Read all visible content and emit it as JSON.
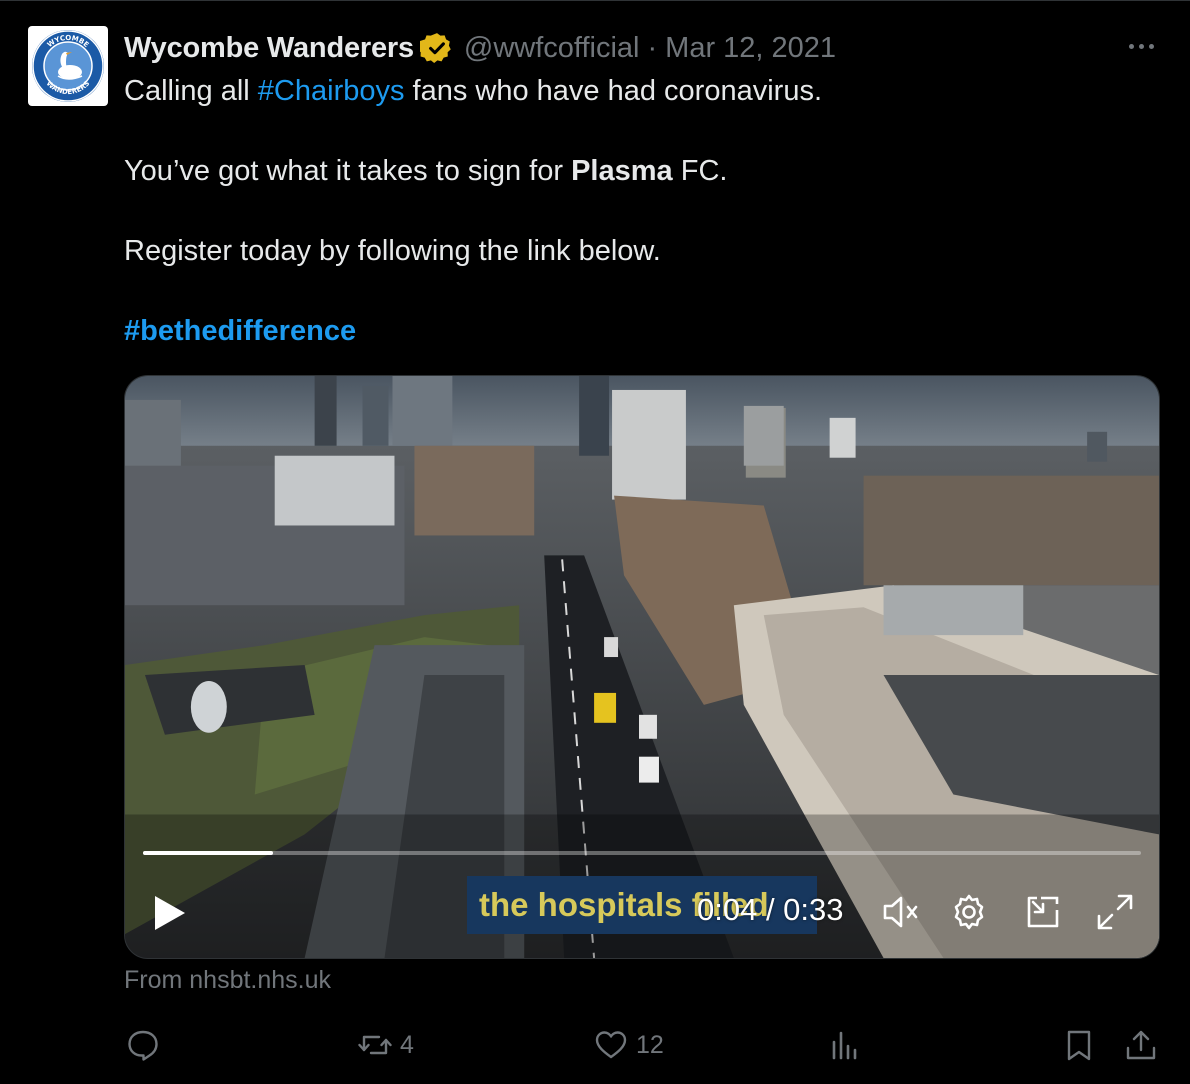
{
  "tweet": {
    "display_name": "Wycombe Wanderers",
    "handle": "@wwfcofficial",
    "separator": "·",
    "date": "Mar 12, 2021",
    "avatar_text_top": "WYCOMBE",
    "avatar_text_bottom": "WANDERERS",
    "text": {
      "line1_prefix": "Calling all ",
      "line1_hashtag": "#Chairboys",
      "line1_suffix": " fans who have had coronavirus.",
      "line2_prefix": "You’ve got what it takes to sign for ",
      "line2_bold": "Plasma",
      "line2_suffix": " FC.",
      "line3": "Register today by following the link below.",
      "hashtag": "#bethedifference"
    }
  },
  "video": {
    "caption": "the hospitals filled",
    "time": "0:04 / 0:33",
    "progress_fraction": 0.13
  },
  "source": "From nhsbt.nhs.uk",
  "actions": {
    "retweets": "4",
    "likes": "12"
  },
  "colors": {
    "background": "#000000",
    "text": "#e7e9ea",
    "muted": "#71767b",
    "link": "#1d9bf0",
    "verified_badge": "#e2b719"
  }
}
